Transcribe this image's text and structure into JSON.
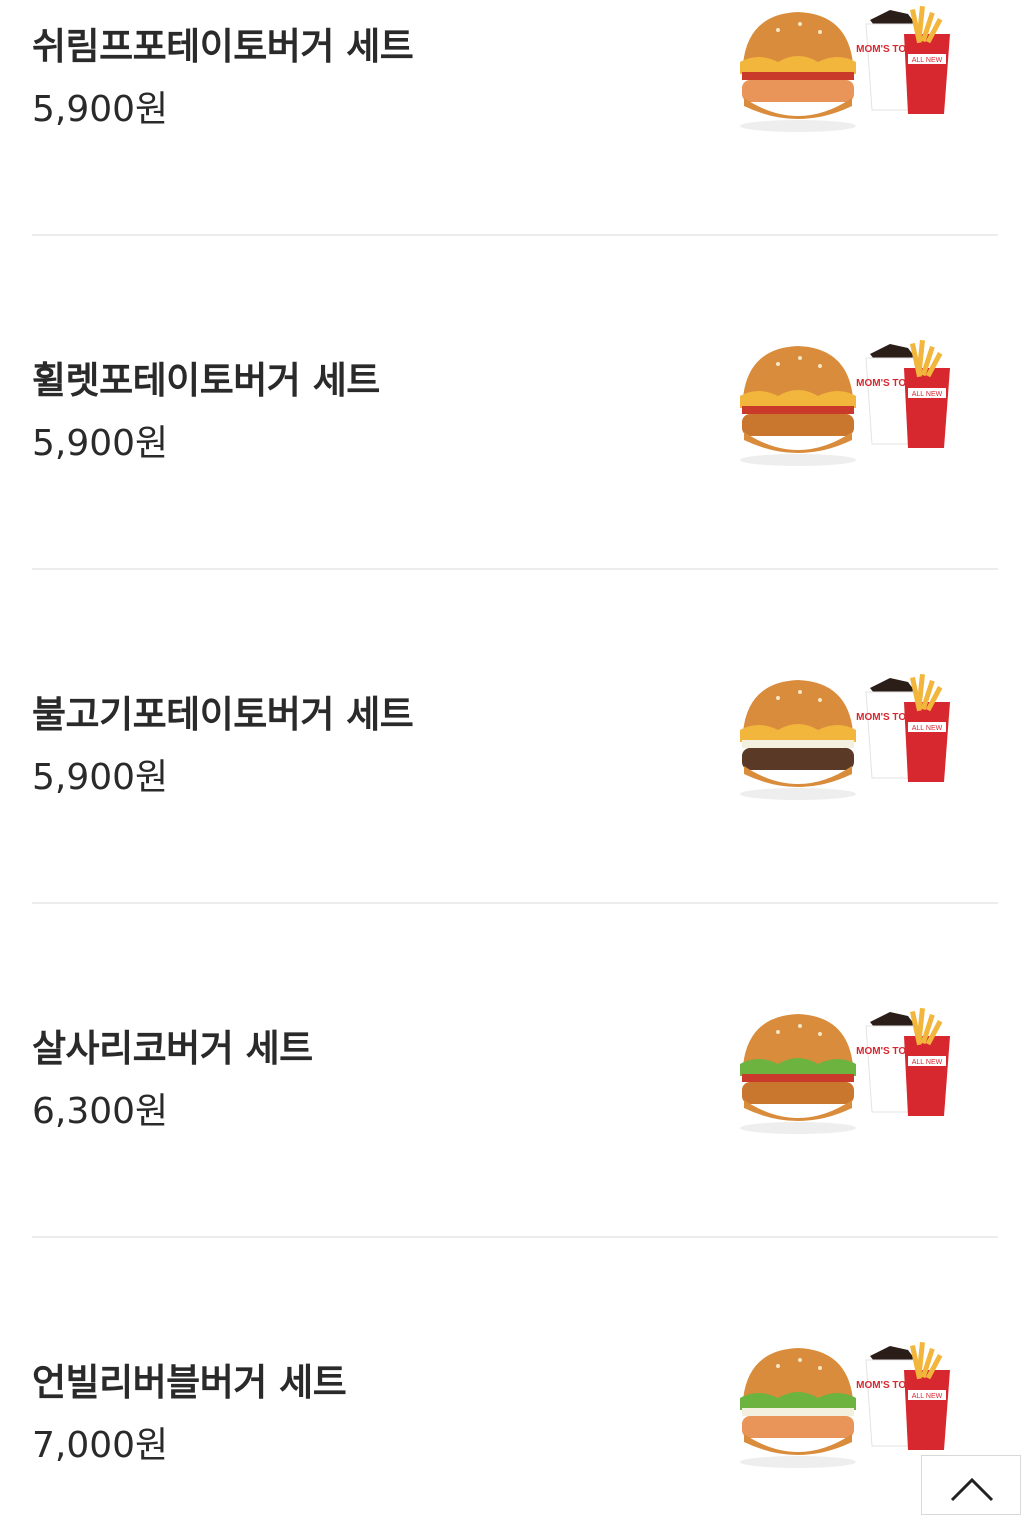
{
  "menu": {
    "items": [
      {
        "name": "쉬림프포테이토버거 세트",
        "price": "5,900원",
        "burger_style": "shrimp"
      },
      {
        "name": "휠렛포테이토버거 세트",
        "price": "5,900원",
        "burger_style": "fillet"
      },
      {
        "name": "불고기포테이토버거 세트",
        "price": "5,900원",
        "burger_style": "bulgogi"
      },
      {
        "name": "살사리코버거 세트",
        "price": "6,300원",
        "burger_style": "salsa"
      },
      {
        "name": "언빌리버블버거 세트",
        "price": "7,000원",
        "burger_style": "unbelievable"
      }
    ],
    "cup_text": "MOM'S TOUCH",
    "fries_box_text": "ALL NEW"
  },
  "scroll_top_icon": "chevron-up-icon",
  "colors": {
    "text": "#2a2a2a",
    "divider": "#ececec",
    "brand_red": "#d7272f",
    "bun": "#d98c3b",
    "fries": "#f2b63c"
  }
}
